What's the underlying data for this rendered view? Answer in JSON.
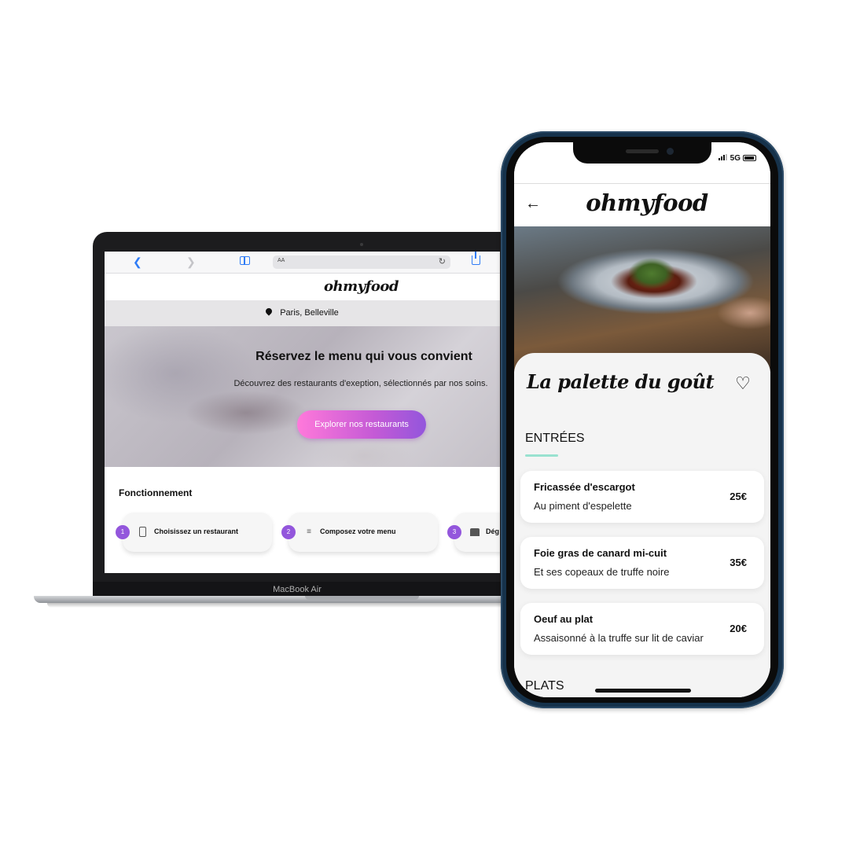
{
  "laptop": {
    "model_label": "MacBook Air",
    "safari": {
      "url_aa": "AA",
      "reload": "↻"
    },
    "site": {
      "logo": "ohmyfood",
      "location": "Paris, Belleville",
      "hero_title": "Réservez le menu qui vous convient",
      "hero_subtitle": "Découvrez des restaurants d'exeption, sélectionnés par nos soins.",
      "cta_label": "Explorer nos restaurants",
      "section_title": "Fonctionnement",
      "steps": [
        {
          "number": "1",
          "icon": "phone-icon",
          "label": "Choisissez un restaurant"
        },
        {
          "number": "2",
          "icon": "list-icon",
          "label": "Composez votre menu"
        },
        {
          "number": "3",
          "icon": "store-icon",
          "label": "Dég"
        }
      ]
    }
  },
  "phone": {
    "status": {
      "network": "5G"
    },
    "logo": "ohmyfood",
    "restaurant_name": "La palette du goût",
    "sections": [
      {
        "title": "ENTRÉES",
        "dishes": [
          {
            "name": "Fricassée d'escargot",
            "description": "Au piment d'espelette",
            "price": "25€"
          },
          {
            "name": "Foie gras de canard mi-cuit",
            "description": "Et ses copeaux de truffe noire",
            "price": "35€"
          },
          {
            "name": "Oeuf au plat",
            "description": "Assaisonné à la truffe sur lit de caviar",
            "price": "20€"
          }
        ]
      },
      {
        "title": "PLATS",
        "dishes": []
      }
    ],
    "colors": {
      "accent_underline": "#99e2d0",
      "cta_gradient_start": "#ff79da",
      "cta_gradient_end": "#9356dc",
      "step_badge": "#9356dc"
    }
  }
}
